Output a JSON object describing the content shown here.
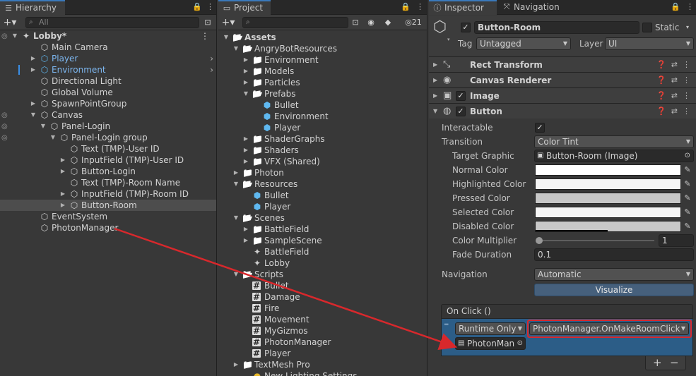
{
  "hierarchy": {
    "tab_label": "Hierarchy",
    "search_placeholder": "All",
    "items": [
      {
        "label": "Lobby*",
        "kind": "scene",
        "blue": false
      },
      {
        "label": "Main Camera",
        "kind": "cube",
        "blue": false
      },
      {
        "label": "Player",
        "kind": "cube-blue",
        "blue": true
      },
      {
        "label": "Environment",
        "kind": "cube-blue",
        "blue": true
      },
      {
        "label": "Directional Light",
        "kind": "cube",
        "blue": false
      },
      {
        "label": "Global Volume",
        "kind": "cube",
        "blue": false
      },
      {
        "label": "SpawnPointGroup",
        "kind": "cube",
        "blue": false
      },
      {
        "label": "Canvas",
        "kind": "cube",
        "blue": false
      },
      {
        "label": "Panel-Login",
        "kind": "cube",
        "blue": false
      },
      {
        "label": "Panel-Login group",
        "kind": "cube",
        "blue": false
      },
      {
        "label": "Text (TMP)-User ID",
        "kind": "cube",
        "blue": false
      },
      {
        "label": "InputField (TMP)-User ID",
        "kind": "cube",
        "blue": false
      },
      {
        "label": "Button-Login",
        "kind": "cube",
        "blue": false
      },
      {
        "label": "Text (TMP)-Room Name",
        "kind": "cube",
        "blue": false
      },
      {
        "label": "InputField (TMP)-Room ID",
        "kind": "cube",
        "blue": false
      },
      {
        "label": "Button-Room",
        "kind": "cube",
        "blue": false
      },
      {
        "label": "EventSystem",
        "kind": "cube",
        "blue": false
      },
      {
        "label": "PhotonManager",
        "kind": "cube",
        "blue": false
      }
    ]
  },
  "project": {
    "tab_label": "Project",
    "hidden_count": "21",
    "items": [
      {
        "label": "Assets",
        "kind": "folder"
      },
      {
        "label": "AngryBotResources",
        "kind": "folder"
      },
      {
        "label": "Environment",
        "kind": "folder"
      },
      {
        "label": "Models",
        "kind": "folder"
      },
      {
        "label": "Particles",
        "kind": "folder"
      },
      {
        "label": "Prefabs",
        "kind": "folder"
      },
      {
        "label": "Bullet",
        "kind": "prefab"
      },
      {
        "label": "Environment",
        "kind": "prefab"
      },
      {
        "label": "Player",
        "kind": "prefab"
      },
      {
        "label": "ShaderGraphs",
        "kind": "folder"
      },
      {
        "label": "Shaders",
        "kind": "folder"
      },
      {
        "label": "VFX (Shared)",
        "kind": "folder"
      },
      {
        "label": "Photon",
        "kind": "folder"
      },
      {
        "label": "Resources",
        "kind": "folder"
      },
      {
        "label": "Bullet",
        "kind": "prefab"
      },
      {
        "label": "Player",
        "kind": "prefab"
      },
      {
        "label": "Scenes",
        "kind": "folder"
      },
      {
        "label": "BattleField",
        "kind": "folder"
      },
      {
        "label": "SampleScene",
        "kind": "folder"
      },
      {
        "label": "BattleField",
        "kind": "scene"
      },
      {
        "label": "Lobby",
        "kind": "scene"
      },
      {
        "label": "Scripts",
        "kind": "folder"
      },
      {
        "label": "Bullet",
        "kind": "script"
      },
      {
        "label": "Damage",
        "kind": "script"
      },
      {
        "label": "Fire",
        "kind": "script"
      },
      {
        "label": "Movement",
        "kind": "script"
      },
      {
        "label": "MyGizmos",
        "kind": "script"
      },
      {
        "label": "PhotonManager",
        "kind": "script"
      },
      {
        "label": "Player",
        "kind": "script"
      },
      {
        "label": "TextMesh Pro",
        "kind": "folder"
      },
      {
        "label": "New Lighting Settings",
        "kind": "lighting"
      }
    ]
  },
  "inspector": {
    "tab_label": "Inspector",
    "nav_tab_label": "Navigation",
    "object_name": "Button-Room",
    "static_label": "Static",
    "tag_label": "Tag",
    "tag_value": "Untagged",
    "layer_label": "Layer",
    "layer_value": "UI",
    "components": [
      {
        "label": "Rect Transform",
        "icon": "rect-transform-icon"
      },
      {
        "label": "Canvas Renderer",
        "icon": "canvas-renderer-icon"
      },
      {
        "label": "Image",
        "icon": "image-icon"
      },
      {
        "label": "Button",
        "icon": "button-icon"
      }
    ],
    "button_props": {
      "interactable_label": "Interactable",
      "transition_label": "Transition",
      "transition_value": "Color Tint",
      "target_graphic_label": "Target Graphic",
      "target_graphic_value": "Button-Room (Image)",
      "normal_color_label": "Normal Color",
      "highlighted_color_label": "Highlighted Color",
      "pressed_color_label": "Pressed Color",
      "selected_color_label": "Selected Color",
      "disabled_color_label": "Disabled Color",
      "color_multiplier_label": "Color Multiplier",
      "color_multiplier_value": "1",
      "fade_duration_label": "Fade Duration",
      "fade_duration_value": "0.1",
      "navigation_label": "Navigation",
      "navigation_value": "Automatic",
      "visualize_label": "Visualize"
    },
    "colors": {
      "normal": "#ffffff",
      "highlighted": "#f5f5f5",
      "pressed": "#c8c8c8",
      "selected": "#f5f5f5",
      "disabled": "#c8c8c8"
    },
    "onclick": {
      "header": "On Click ()",
      "runtime_value": "Runtime Only",
      "function_value": "PhotonManager.OnMakeRoomClick",
      "object_value": "PhotonMan"
    }
  },
  "accent_colors": {
    "selection_blue": "#2c5d87",
    "highlight_red": "#d8282c",
    "prefab_blue": "#5fb8f0"
  }
}
